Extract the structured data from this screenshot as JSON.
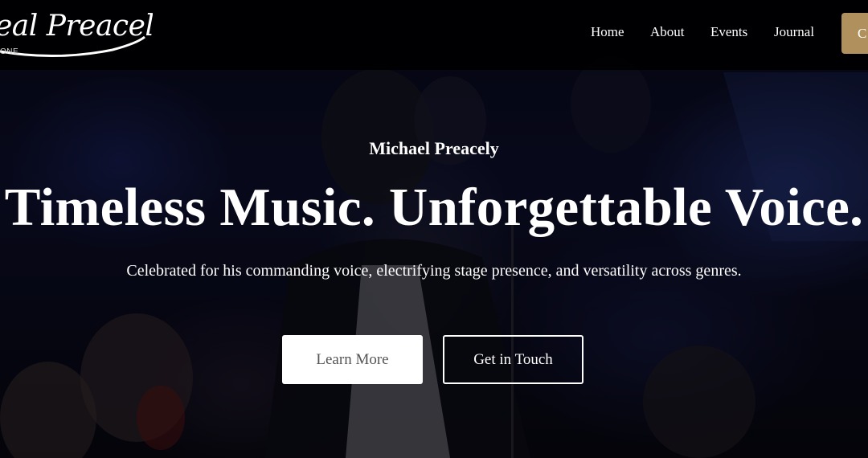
{
  "brand": {
    "logo_text": "eal Preacely",
    "logo_subtext": "ONE"
  },
  "nav": {
    "items": [
      {
        "label": "Home"
      },
      {
        "label": "About"
      },
      {
        "label": "Events"
      },
      {
        "label": "Journal"
      }
    ],
    "cta_label": "C"
  },
  "hero": {
    "eyebrow": "Michael Preacely",
    "headline": "Timeless Music. Unforgettable Voice.",
    "subtext": "Celebrated for his commanding voice, electrifying stage presence, and versatility across genres.",
    "primary_button": "Learn More",
    "secondary_button": "Get in Touch"
  },
  "colors": {
    "header_bg": "#000000",
    "accent": "#b0905c",
    "text": "#ffffff",
    "button_primary_bg": "#ffffff",
    "button_primary_text": "#555555"
  }
}
